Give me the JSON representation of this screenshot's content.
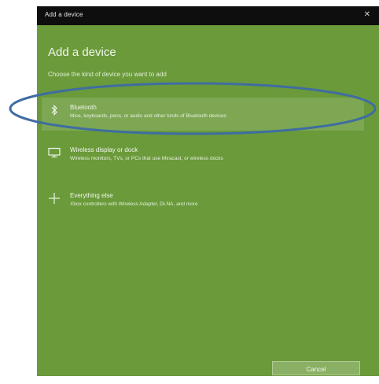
{
  "window": {
    "title": "Add a device",
    "close_glyph": "✕"
  },
  "heading": "Add a device",
  "subheading": "Choose the kind of device you want to add",
  "options": [
    {
      "icon": "bluetooth-icon",
      "label": "Bluetooth",
      "description": "Mice, keyboards, pens, or audio and other kinds of Bluetooth devices"
    },
    {
      "icon": "monitor-icon",
      "label": "Wireless display or dock",
      "description": "Wireless monitors, TVs, or PCs that use Miracast, or wireless docks"
    },
    {
      "icon": "plus-icon",
      "label": "Everything else",
      "description": "Xbox controllers with Wireless Adapter, DLNA, and more"
    }
  ],
  "footer": {
    "cancel_label": "Cancel"
  },
  "colors": {
    "window_bg": "#6a9a3a",
    "titlebar_bg": "#0e0e0e",
    "annotation_stroke": "#3f6da1"
  }
}
